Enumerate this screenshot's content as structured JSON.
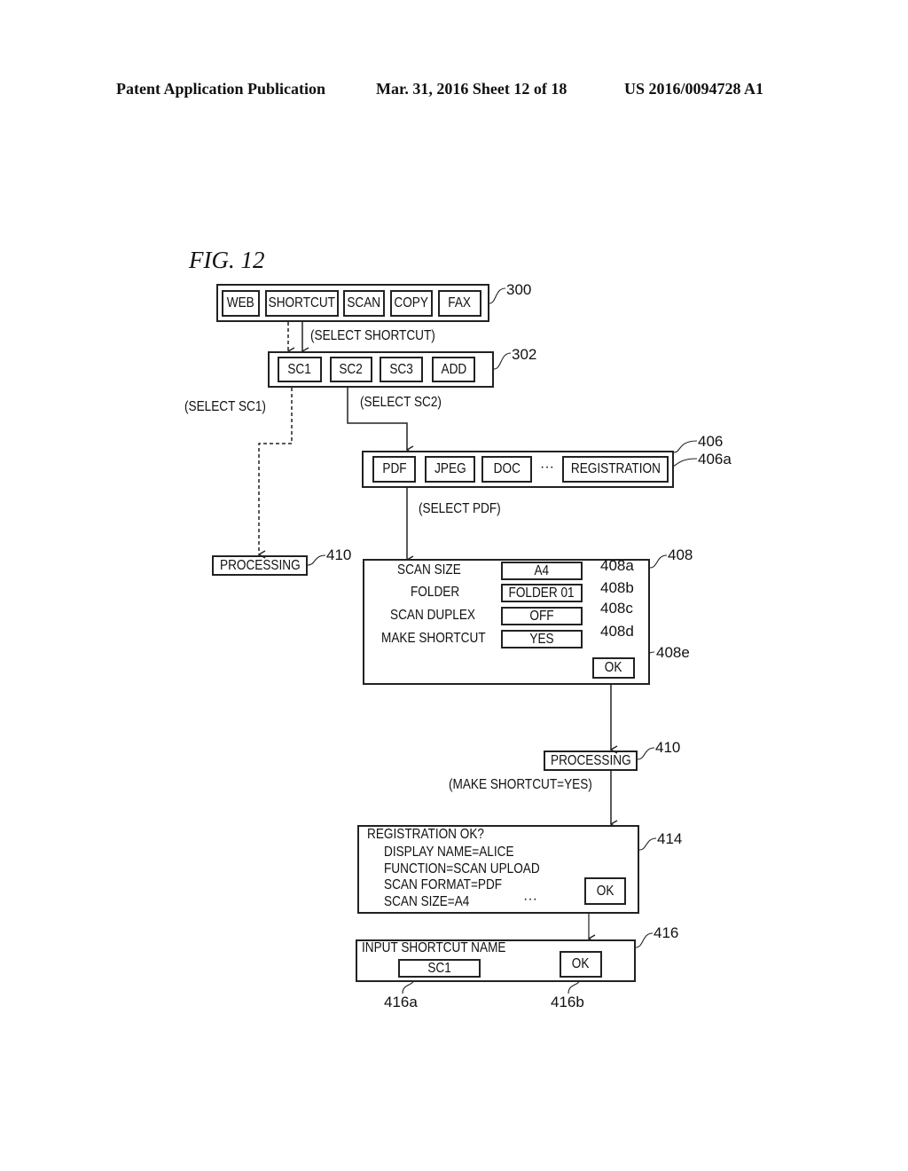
{
  "header": {
    "publication": "Patent Application Publication",
    "date_sheet": "Mar. 31, 2016  Sheet 12 of 18",
    "patent_number": "US 2016/0094728 A1"
  },
  "figure": {
    "title": "FIG. 12"
  },
  "screen_300": {
    "ref": "300",
    "buttons": [
      "WEB",
      "SHORTCUT",
      "SCAN",
      "COPY",
      "FAX"
    ]
  },
  "transition_select_shortcut": "(SELECT SHORTCUT)",
  "screen_302": {
    "ref": "302",
    "buttons": [
      "SC1",
      "SC2",
      "SC3",
      "ADD"
    ]
  },
  "transition_select_sc1": "(SELECT SC1)",
  "transition_select_sc2": "(SELECT SC2)",
  "screen_406": {
    "ref": "406",
    "ref_registration": "406a",
    "buttons": [
      "PDF",
      "JPEG",
      "DOC",
      "REGISTRATION"
    ],
    "ellipsis": "···"
  },
  "transition_select_pdf": "(SELECT PDF)",
  "processing_left": {
    "label": "PROCESSING",
    "ref": "410"
  },
  "screen_408": {
    "ref": "408",
    "settings": [
      {
        "label": "SCAN SIZE",
        "value": "A4",
        "ref": "408a"
      },
      {
        "label": "FOLDER",
        "value": "FOLDER 01",
        "ref": "408b"
      },
      {
        "label": "SCAN DUPLEX",
        "value": "OFF",
        "ref": "408c"
      },
      {
        "label": "MAKE SHORTCUT",
        "value": "YES",
        "ref": "408d"
      }
    ],
    "ok_label": "OK",
    "ok_ref": "408e"
  },
  "processing_right": {
    "label": "PROCESSING",
    "ref": "410"
  },
  "transition_make_shortcut": "(MAKE SHORTCUT=YES)",
  "screen_414": {
    "ref": "414",
    "title": "REGISTRATION OK?",
    "lines": [
      "DISPLAY NAME=ALICE",
      "FUNCTION=SCAN UPLOAD",
      "SCAN FORMAT=PDF",
      "SCAN SIZE=A4"
    ],
    "ellipsis": "···",
    "ok_label": "OK"
  },
  "screen_416": {
    "ref": "416",
    "title": "INPUT SHORTCUT NAME",
    "input_value": "SC1",
    "input_ref": "416a",
    "ok_label": "OK",
    "ok_ref": "416b"
  }
}
